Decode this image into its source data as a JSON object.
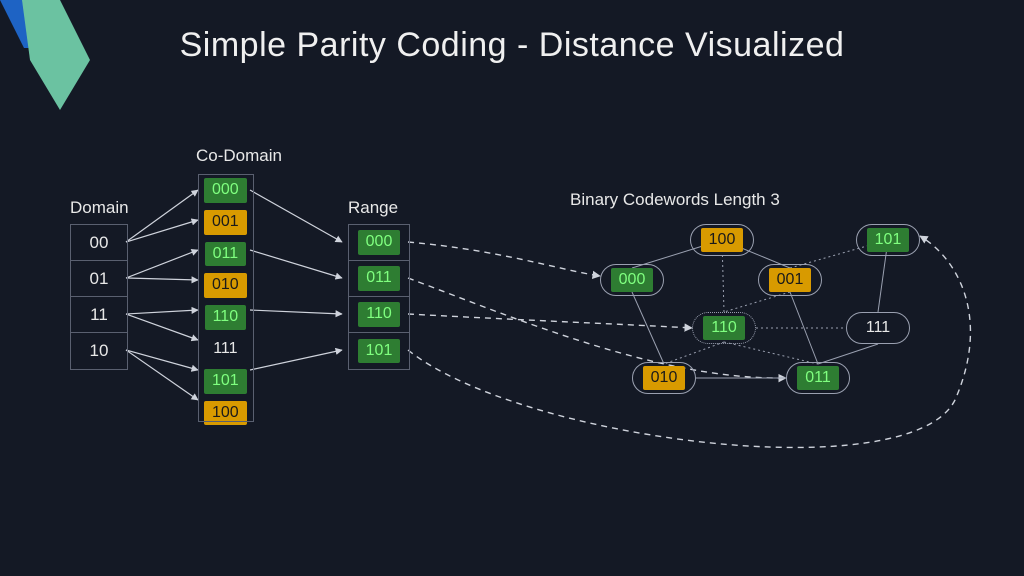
{
  "title": "Simple Parity Coding - Distance Visualized",
  "labels": {
    "domain": "Domain",
    "codomain": "Co-Domain",
    "range": "Range",
    "graph": "Binary Codewords Length 3"
  },
  "domain": [
    "00",
    "01",
    "11",
    "10"
  ],
  "codomain": [
    {
      "v": "000",
      "c": "green"
    },
    {
      "v": "001",
      "c": "amber"
    },
    {
      "v": "011",
      "c": "green"
    },
    {
      "v": "010",
      "c": "amber"
    },
    {
      "v": "110",
      "c": "green"
    },
    {
      "v": "111",
      "c": "plain"
    },
    {
      "v": "101",
      "c": "green"
    },
    {
      "v": "100",
      "c": "amber"
    }
  ],
  "range": [
    {
      "v": "000",
      "c": "green"
    },
    {
      "v": "011",
      "c": "green"
    },
    {
      "v": "110",
      "c": "green"
    },
    {
      "v": "101",
      "c": "green"
    }
  ],
  "graph_nodes": {
    "n100": {
      "v": "100",
      "c": "amber"
    },
    "n101": {
      "v": "101",
      "c": "green"
    },
    "n000": {
      "v": "000",
      "c": "green"
    },
    "n001": {
      "v": "001",
      "c": "amber"
    },
    "n110": {
      "v": "110",
      "c": "green"
    },
    "n111": {
      "v": "111",
      "c": "plain"
    },
    "n010": {
      "v": "010",
      "c": "amber"
    },
    "n011": {
      "v": "011",
      "c": "green"
    }
  },
  "colors": {
    "bg": "#141925",
    "green_bg": "#2e7d32",
    "green_fg": "#7fff7f",
    "amber_bg": "#d89a00",
    "accent_blue": "#1e63c4",
    "accent_teal": "#6bc2a1"
  }
}
